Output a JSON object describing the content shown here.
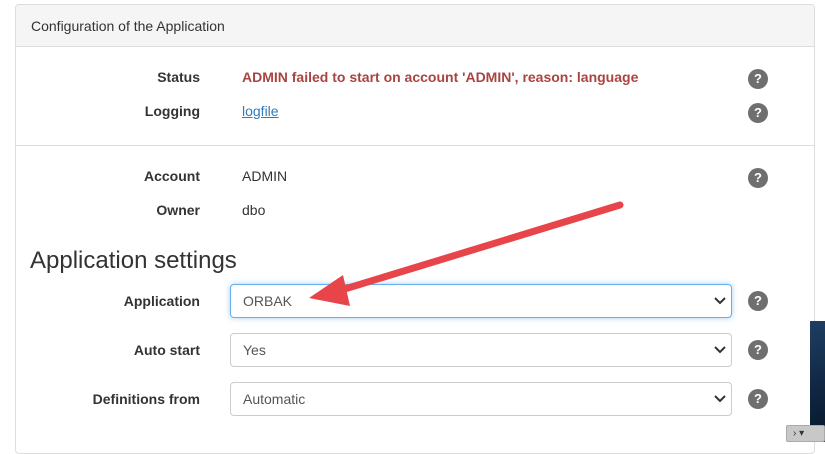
{
  "panel": {
    "title": "Configuration of the Application"
  },
  "info": {
    "status": {
      "label": "Status",
      "value": "ADMIN failed to start on account 'ADMIN', reason: language"
    },
    "logging": {
      "label": "Logging",
      "value": "logfile"
    },
    "account": {
      "label": "Account",
      "value": "ADMIN"
    },
    "owner": {
      "label": "Owner",
      "value": "dbo"
    }
  },
  "settings": {
    "title": "Application settings",
    "application": {
      "label": "Application",
      "value": "ORBAK"
    },
    "auto_start": {
      "label": "Auto start",
      "value": "Yes"
    },
    "definitions_from": {
      "label": "Definitions from",
      "value": "Automatic"
    }
  },
  "help": {
    "glyph": "?"
  },
  "colors": {
    "status_error": "#a94442",
    "link": "#337ab7",
    "help_icon": "#6f6f6f",
    "annotation_arrow": "#e8454b",
    "focus_border": "#66afe9"
  },
  "icons": {
    "help": "help-icon",
    "dropdown": "chevron-down-icon",
    "annotation": "red-arrow-annotation"
  }
}
